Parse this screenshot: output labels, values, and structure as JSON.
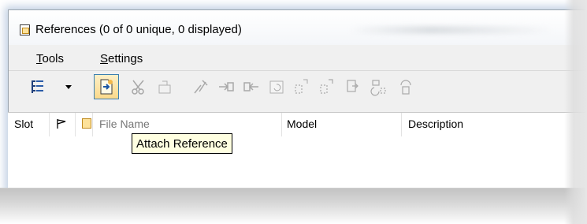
{
  "window": {
    "title": "References (0 of 0 unique, 0 displayed)",
    "title_icon": "document-icon"
  },
  "menu": {
    "items": [
      {
        "label": "Tools",
        "accel": "T",
        "rest": "ools"
      },
      {
        "label": "Settings",
        "accel": "S",
        "rest": "ettings"
      }
    ]
  },
  "toolbar": {
    "icons": [
      "tree-view-icon",
      "dropdown-arrow-icon",
      "attach-reference-icon",
      "detach-scissors-icon",
      "reload-icon",
      "exchange-icon",
      "move-icon",
      "copy-icon",
      "rotate-icon",
      "scale-icon",
      "mirror-horizontal-icon",
      "mirror-vertical-icon",
      "clip-boundary-icon",
      "clip-mask-icon"
    ],
    "active_icon": "attach-reference-icon"
  },
  "table": {
    "columns": [
      "Slot",
      "",
      "",
      "File Name",
      "Model",
      "Description"
    ],
    "rows": []
  },
  "tooltip": {
    "text": "Attach Reference"
  },
  "colors": {
    "accent": "#3c7fb1",
    "tooltip_bg": "#ffffe1",
    "active_button_bg": "#fbd98a"
  }
}
